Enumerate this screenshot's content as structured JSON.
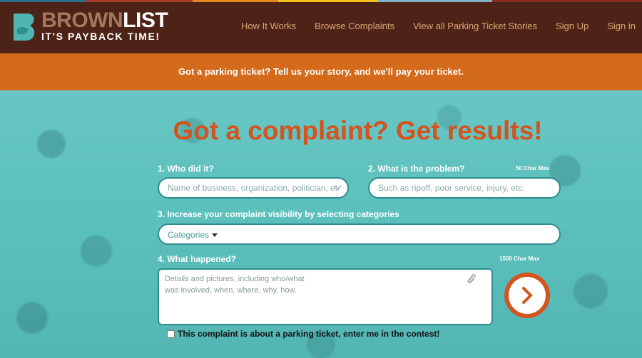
{
  "brand": {
    "word_part1": "BROWN",
    "word_part2": "LIST",
    "tagline": "IT'S PAYBACK TIME!",
    "colors": {
      "header_bg": "#4e2317",
      "banner_bg": "#d46a1c",
      "accent": "#d4531e",
      "teal": "#5fc3c0",
      "logo_mark": "#4fb5b3"
    }
  },
  "nav": {
    "items": [
      {
        "label": "How It Works"
      },
      {
        "label": "Browse Complaints"
      },
      {
        "label": "View all Parking Ticket Stories"
      },
      {
        "label": "Sign Up"
      },
      {
        "label": "Sign in"
      }
    ]
  },
  "banner": {
    "text": "Got a parking ticket? Tell us your story, and we'll pay your ticket."
  },
  "form": {
    "headline": "Got a complaint? Get results!",
    "who": {
      "label": "1. Who did it?",
      "placeholder": "Name of business, organization, politician, etc"
    },
    "problem": {
      "label": "2. What is the problem?",
      "max": "50 Char Max",
      "placeholder": "Such as ripoff, poor service, injury, etc."
    },
    "categories": {
      "label": "3. Increase your complaint visibility by selecting categories",
      "value": "Categories"
    },
    "happened": {
      "label": "4. What happened?",
      "max": "1500 Char Max",
      "placeholder": "Details and pictures, including who/what\nwas involved, when, where, why, how."
    },
    "contest": {
      "label": "This complaint is about a parking ticket, enter me in the contest!"
    },
    "icons": {
      "submit": "chevron-right-icon",
      "attach": "paperclip-icon",
      "dropdown": "chevron-down-icon"
    }
  }
}
